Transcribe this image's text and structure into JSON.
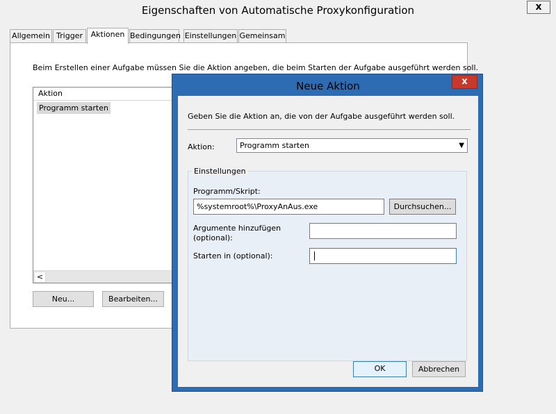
{
  "main_window": {
    "title": "Eigenschaften von Automatische Proxykonfiguration",
    "close_label": "x",
    "tabs": [
      {
        "label": "Allgemein"
      },
      {
        "label": "Trigger"
      },
      {
        "label": "Aktionen",
        "active": true
      },
      {
        "label": "Bedingungen"
      },
      {
        "label": "Einstellungen"
      },
      {
        "label": "Gemeinsam"
      }
    ],
    "description": "Beim Erstellen einer Aufgabe müssen Sie die Aktion angeben, die beim Starten der Aufgabe ausgeführt werden soll.",
    "action_list": {
      "column_header": "Aktion",
      "rows": [
        {
          "action": "Programm starten"
        }
      ],
      "scroll_left_glyph": "<"
    },
    "buttons": {
      "new": "Neu...",
      "edit": "Bearbeiten..."
    }
  },
  "dialog": {
    "title": "Neue Aktion",
    "close_label": "x",
    "instruction": "Geben Sie die Aktion an, die von der Aufgabe ausgeführt werden soll.",
    "action_label": "Aktion:",
    "action_value": "Programm starten",
    "settings_group": "Einstellungen",
    "program_label": "Programm/Skript:",
    "program_value": "%systemroot%\\ProxyAnAus.exe",
    "browse_label": "Durchsuchen...",
    "arguments_label": "Argumente hinzufügen (optional):",
    "arguments_value": "",
    "start_in_label": "Starten in (optional):",
    "start_in_value": "",
    "ok_label": "OK",
    "cancel_label": "Abbrechen"
  },
  "colors": {
    "dialog_frame": "#2d6bb2",
    "dialog_close": "#c7392c",
    "group_background": "#e9eff6",
    "window_background": "#f0f0f0"
  }
}
